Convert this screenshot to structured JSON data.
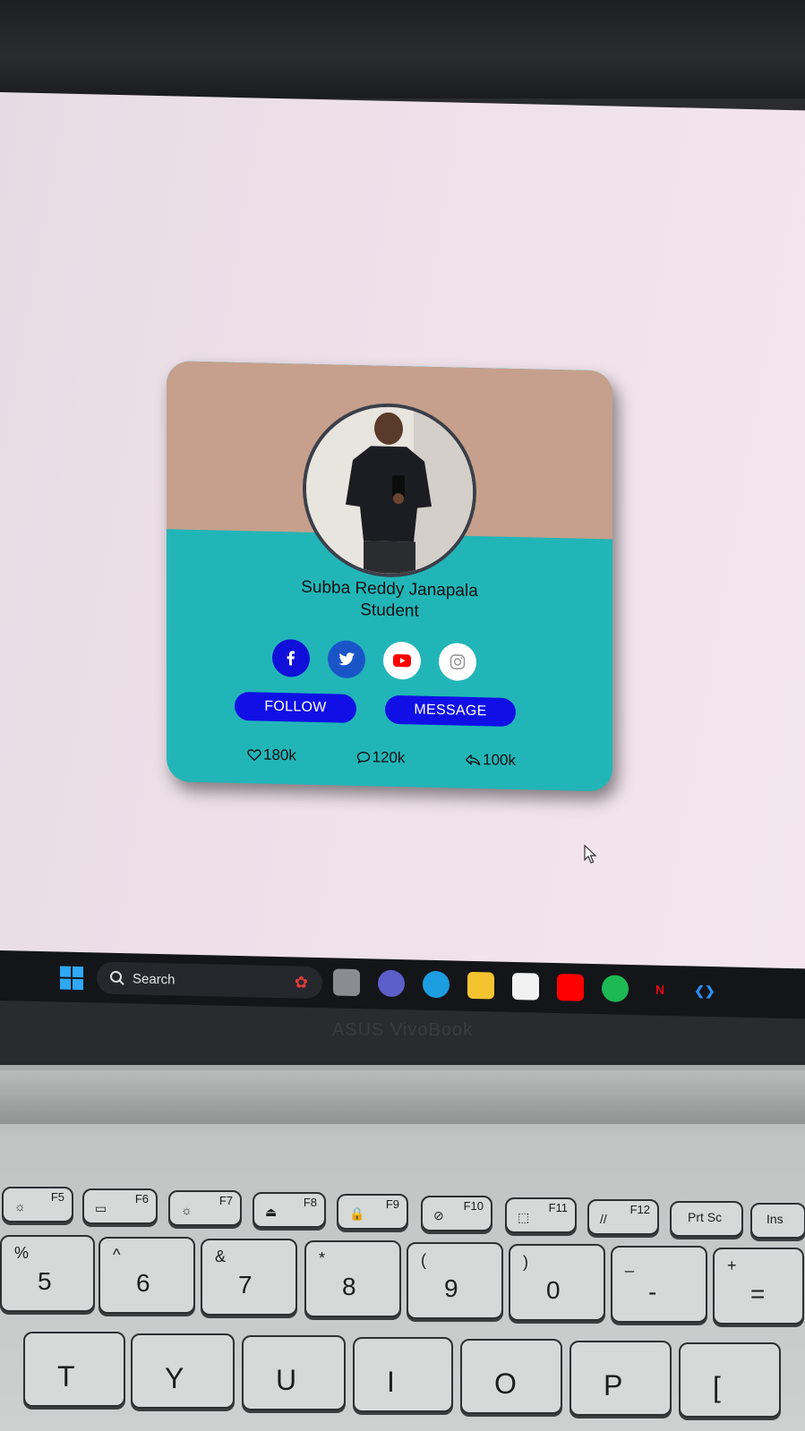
{
  "profile_card": {
    "name": "Subba Reddy Janapala",
    "role": "Student",
    "socials": [
      {
        "icon": "facebook-icon",
        "color": "#1010d8"
      },
      {
        "icon": "twitter-icon",
        "color": "#1a55c8"
      },
      {
        "icon": "youtube-icon",
        "color": "#ff0000"
      },
      {
        "icon": "instagram-icon",
        "color": "#ffffff"
      }
    ],
    "follow_label": "FOLLOW",
    "message_label": "MESSAGE",
    "stats": [
      {
        "icon": "heart-icon",
        "value": "180k"
      },
      {
        "icon": "comment-icon",
        "value": "120k"
      },
      {
        "icon": "share-icon",
        "value": "100k"
      }
    ],
    "colors": {
      "top": "#c6a08c",
      "bottom": "#22b5b8",
      "button": "#1010e6"
    }
  },
  "taskbar": {
    "search_label": "Search",
    "pinned_apps": [
      "widgets-gift-icon",
      "task-view-icon",
      "teams-icon",
      "edge-icon",
      "file-explorer-icon",
      "store-icon",
      "youtube-icon",
      "spotify-icon",
      "netflix-icon",
      "vscode-icon"
    ]
  },
  "laptop_brand": "ASUS VivoBook",
  "keyboard": {
    "function_keys": [
      {
        "label": "F5",
        "glyph": "☼"
      },
      {
        "label": "F6",
        "glyph": "▭"
      },
      {
        "label": "F7",
        "glyph": "☼"
      },
      {
        "label": "F8",
        "glyph": "⏏"
      },
      {
        "label": "F9",
        "glyph": "🔒"
      },
      {
        "label": "F10",
        "glyph": "⊘"
      },
      {
        "label": "F11",
        "glyph": "⬚"
      },
      {
        "label": "F12",
        "glyph": "//"
      },
      {
        "label": "Prt Sc",
        "glyph": ""
      },
      {
        "label": "Ins",
        "glyph": ""
      }
    ],
    "number_keys": [
      {
        "top": "%",
        "bottom": "5"
      },
      {
        "top": "^",
        "bottom": "6"
      },
      {
        "top": "&",
        "bottom": "7"
      },
      {
        "top": "*",
        "bottom": "8"
      },
      {
        "top": "(",
        "bottom": "9"
      },
      {
        "top": ")",
        "bottom": "0"
      },
      {
        "top": "_",
        "bottom": "-"
      },
      {
        "top": "+",
        "bottom": "="
      }
    ],
    "letter_keys": [
      "T",
      "Y",
      "U",
      "I",
      "O",
      "P",
      "["
    ]
  }
}
